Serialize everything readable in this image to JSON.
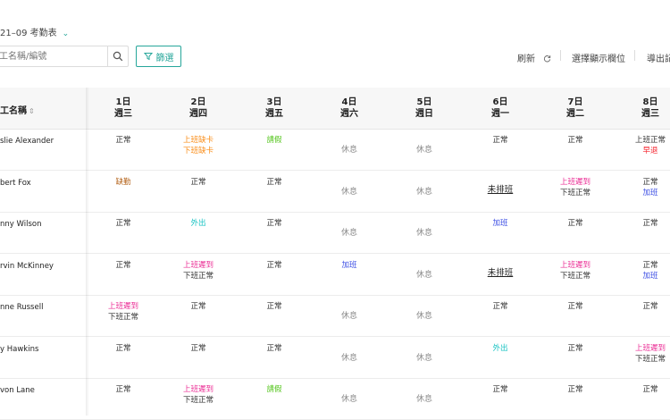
{
  "header": {
    "title": "21–09 考勤表",
    "search_placeholder": "工名稱/編號",
    "filter_label": "篩選",
    "refresh_label": "刷新",
    "columns_label": "選擇顯示欄位",
    "export_label": "導出記"
  },
  "table": {
    "name_header": "工名稱",
    "days": [
      {
        "date": "1日",
        "weekday": "週三"
      },
      {
        "date": "2日",
        "weekday": "週四"
      },
      {
        "date": "3日",
        "weekday": "週五"
      },
      {
        "date": "4日",
        "weekday": "週六"
      },
      {
        "date": "5日",
        "weekday": "週日"
      },
      {
        "date": "6日",
        "weekday": "週一"
      },
      {
        "date": "7日",
        "weekday": "週二"
      },
      {
        "date": "8日",
        "weekday": "週三"
      }
    ],
    "rows": [
      {
        "name": "slie Alexander",
        "cells": [
          [
            {
              "t": "正常",
              "c": "normal"
            }
          ],
          [
            {
              "t": "上班缺卡",
              "c": "orange"
            },
            {
              "t": "下班缺卡",
              "c": "orange"
            }
          ],
          [
            {
              "t": "請假",
              "c": "green"
            }
          ],
          [
            {
              "t": "休息",
              "c": "rest"
            }
          ],
          [
            {
              "t": "休息",
              "c": "rest"
            }
          ],
          [
            {
              "t": "正常",
              "c": "normal"
            }
          ],
          [
            {
              "t": "正常",
              "c": "normal"
            }
          ],
          [
            {
              "t": "上班正常",
              "c": "normal"
            },
            {
              "t": "早退",
              "c": "red"
            }
          ]
        ]
      },
      {
        "name": "bert Fox",
        "cells": [
          [
            {
              "t": "缺勤",
              "c": "brown"
            }
          ],
          [
            {
              "t": "正常",
              "c": "normal"
            }
          ],
          [
            {
              "t": "正常",
              "c": "normal"
            }
          ],
          [
            {
              "t": "休息",
              "c": "rest"
            }
          ],
          [
            {
              "t": "休息",
              "c": "rest"
            }
          ],
          [
            {
              "t": "未排班",
              "c": "unshift"
            }
          ],
          [
            {
              "t": "上班遲到",
              "c": "pink"
            },
            {
              "t": "下班正常",
              "c": "normal"
            }
          ],
          [
            {
              "t": "正常",
              "c": "normal"
            },
            {
              "t": "加班",
              "c": "blue"
            }
          ]
        ]
      },
      {
        "name": "nny Wilson",
        "cells": [
          [
            {
              "t": "正常",
              "c": "normal"
            }
          ],
          [
            {
              "t": "外出",
              "c": "cyan"
            }
          ],
          [
            {
              "t": "正常",
              "c": "normal"
            }
          ],
          [
            {
              "t": "休息",
              "c": "rest"
            }
          ],
          [
            {
              "t": "休息",
              "c": "rest"
            }
          ],
          [
            {
              "t": "加班",
              "c": "blue"
            }
          ],
          [
            {
              "t": "正常",
              "c": "normal"
            }
          ],
          [
            {
              "t": "正常",
              "c": "normal"
            }
          ]
        ]
      },
      {
        "name": "rvin McKinney",
        "cells": [
          [
            {
              "t": "正常",
              "c": "normal"
            }
          ],
          [
            {
              "t": "上班遲到",
              "c": "pink"
            },
            {
              "t": "下班正常",
              "c": "normal"
            }
          ],
          [
            {
              "t": "正常",
              "c": "normal"
            }
          ],
          [
            {
              "t": "加班",
              "c": "blue"
            }
          ],
          [
            {
              "t": "休息",
              "c": "rest"
            }
          ],
          [
            {
              "t": "未排班",
              "c": "unshift"
            }
          ],
          [
            {
              "t": "上班遲到",
              "c": "pink"
            },
            {
              "t": "下班正常",
              "c": "normal"
            }
          ],
          [
            {
              "t": "正常",
              "c": "normal"
            },
            {
              "t": "加班",
              "c": "blue"
            }
          ]
        ]
      },
      {
        "name": "nne Russell",
        "cells": [
          [
            {
              "t": "上班遲到",
              "c": "pink"
            },
            {
              "t": "下班正常",
              "c": "normal"
            }
          ],
          [
            {
              "t": "正常",
              "c": "normal"
            }
          ],
          [
            {
              "t": "正常",
              "c": "normal"
            }
          ],
          [
            {
              "t": "休息",
              "c": "rest"
            }
          ],
          [
            {
              "t": "休息",
              "c": "rest"
            }
          ],
          [
            {
              "t": "正常",
              "c": "normal"
            }
          ],
          [
            {
              "t": "正常",
              "c": "normal"
            }
          ],
          [
            {
              "t": "正常",
              "c": "normal"
            }
          ]
        ]
      },
      {
        "name": "y Hawkins",
        "cells": [
          [
            {
              "t": "正常",
              "c": "normal"
            }
          ],
          [
            {
              "t": "正常",
              "c": "normal"
            }
          ],
          [
            {
              "t": "正常",
              "c": "normal"
            }
          ],
          [
            {
              "t": "休息",
              "c": "rest"
            }
          ],
          [
            {
              "t": "休息",
              "c": "rest"
            }
          ],
          [
            {
              "t": "外出",
              "c": "cyan"
            }
          ],
          [
            {
              "t": "正常",
              "c": "normal"
            }
          ],
          [
            {
              "t": "上班遲到",
              "c": "pink"
            },
            {
              "t": "下班正常",
              "c": "normal"
            }
          ]
        ]
      },
      {
        "name": "von Lane",
        "cells": [
          [
            {
              "t": "正常",
              "c": "normal"
            }
          ],
          [
            {
              "t": "上班遲到",
              "c": "pink"
            },
            {
              "t": "下班正常",
              "c": "normal"
            }
          ],
          [
            {
              "t": "請假",
              "c": "green"
            }
          ],
          [
            {
              "t": "休息",
              "c": "rest"
            }
          ],
          [
            {
              "t": "休息",
              "c": "rest"
            }
          ],
          [
            {
              "t": "正常",
              "c": "normal"
            }
          ],
          [
            {
              "t": "正常",
              "c": "normal"
            }
          ],
          [
            {
              "t": "正常",
              "c": "normal"
            }
          ]
        ]
      }
    ]
  },
  "colors": {
    "accent": "#26a69a",
    "late": "#eb2f96",
    "missing_punch": "#fa8c16",
    "leave": "#52c41a",
    "overtime": "#3f51e5",
    "outing": "#13c2c2",
    "early_leave": "#f5222d",
    "absent": "#b5651d"
  },
  "icons": {
    "title_chevron": "chevron-down-icon",
    "search": "search-icon",
    "filter": "filter-icon",
    "refresh": "refresh-icon",
    "sort": "sort-icon"
  }
}
